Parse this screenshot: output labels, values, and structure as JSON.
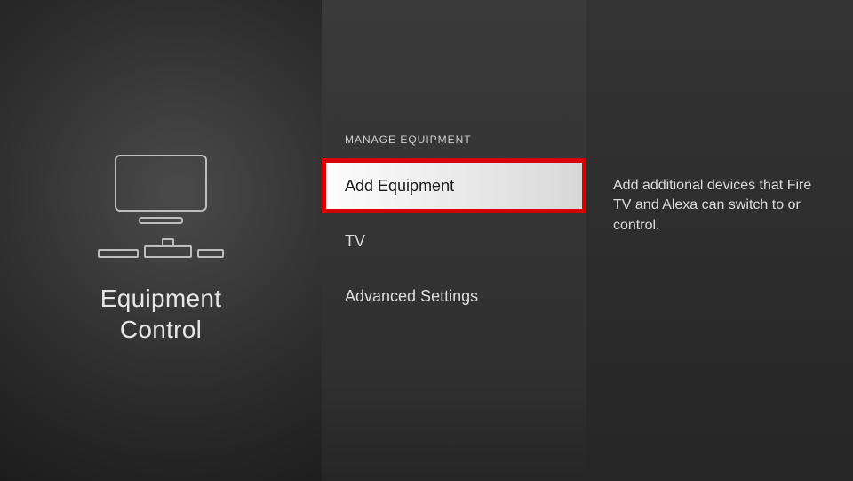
{
  "left": {
    "title_line1": "Equipment",
    "title_line2": "Control"
  },
  "menu": {
    "section_header": "MANAGE EQUIPMENT",
    "items": [
      {
        "label": "Add Equipment",
        "selected": true
      },
      {
        "label": "TV",
        "selected": false
      },
      {
        "label": "Advanced Settings",
        "selected": false
      }
    ]
  },
  "right": {
    "description": "Add additional devices that Fire TV and Alexa can switch to or control."
  }
}
